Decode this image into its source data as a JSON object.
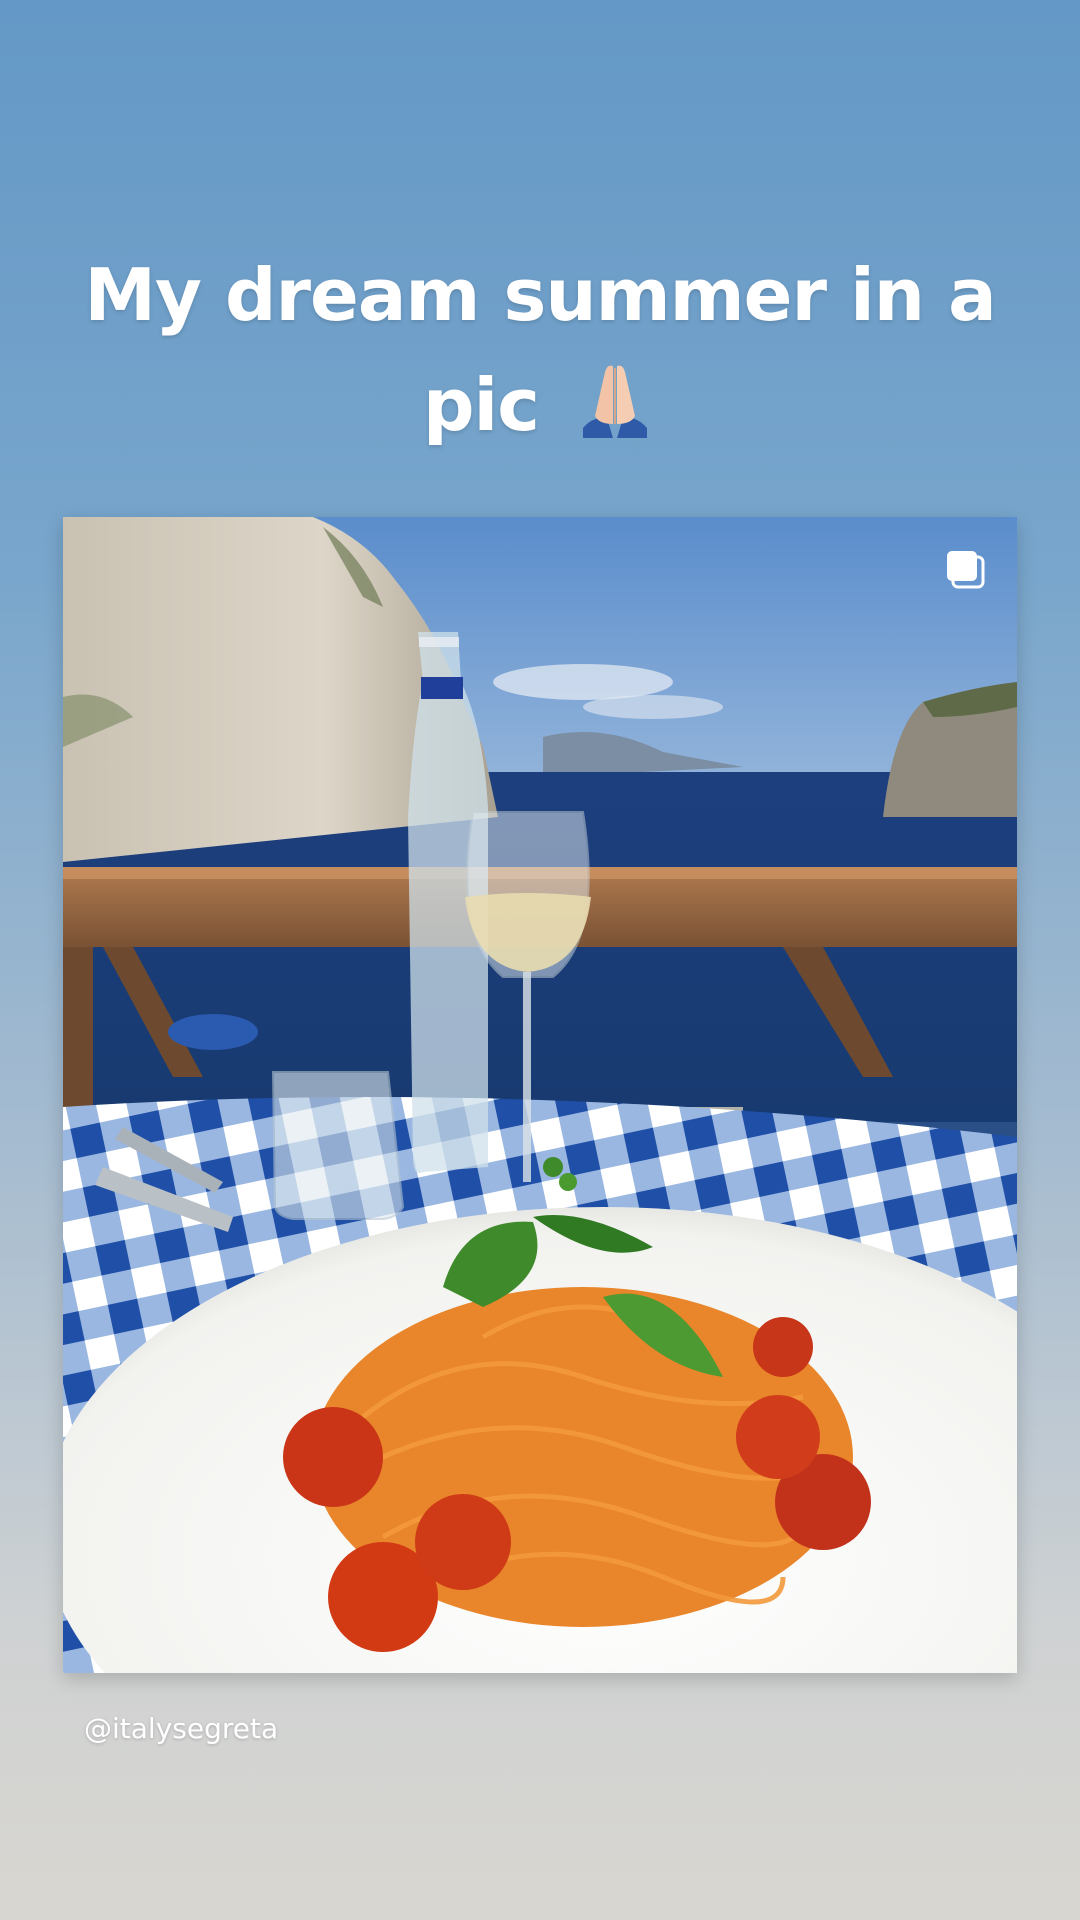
{
  "story": {
    "caption": "My dream summer in a pic",
    "caption_emoji": "folded-hands",
    "credit": "@italysegreta",
    "post": {
      "multi_photo_icon": "carousel-icon",
      "photo_subject": "spaghetti-pomodoro-terrace-photo"
    },
    "colors": {
      "bg_top": "#6498c6",
      "bg_bottom": "#d8d6d0",
      "text": "#ffffff"
    }
  }
}
